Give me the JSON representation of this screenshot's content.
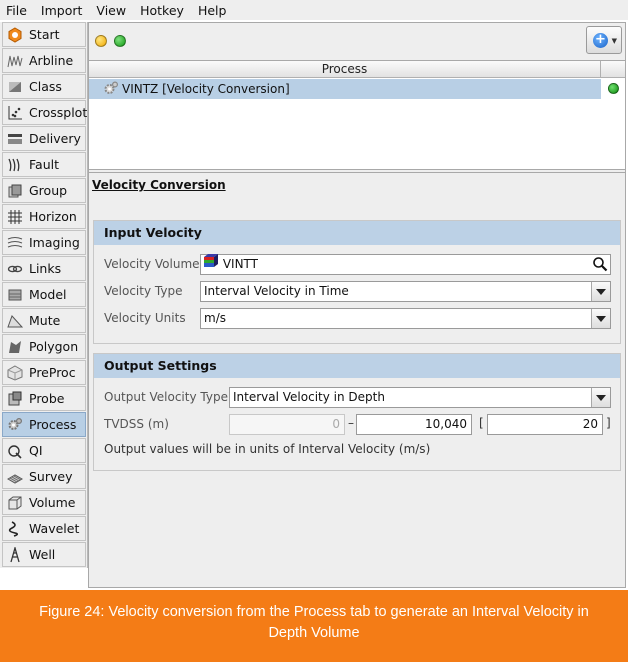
{
  "menu": [
    "File",
    "Import",
    "View",
    "Hotkey",
    "Help"
  ],
  "sidebar": {
    "tabs": [
      {
        "label": "Start",
        "icon": "start-icon"
      },
      {
        "label": "Arbline",
        "icon": "arbline-icon"
      },
      {
        "label": "Class",
        "icon": "class-icon"
      },
      {
        "label": "Crossplot",
        "icon": "crossplot-icon"
      },
      {
        "label": "Delivery",
        "icon": "delivery-icon"
      },
      {
        "label": "Fault",
        "icon": "fault-icon"
      },
      {
        "label": "Group",
        "icon": "group-icon"
      },
      {
        "label": "Horizon",
        "icon": "horizon-icon"
      },
      {
        "label": "Imaging",
        "icon": "imaging-icon"
      },
      {
        "label": "Links",
        "icon": "links-icon"
      },
      {
        "label": "Model",
        "icon": "model-icon"
      },
      {
        "label": "Mute",
        "icon": "mute-icon"
      },
      {
        "label": "Polygon",
        "icon": "polygon-icon"
      },
      {
        "label": "PreProc",
        "icon": "preproc-icon"
      },
      {
        "label": "Probe",
        "icon": "probe-icon"
      },
      {
        "label": "Process",
        "icon": "process-icon",
        "active": true
      },
      {
        "label": "QI",
        "icon": "qi-icon"
      },
      {
        "label": "Survey",
        "icon": "survey-icon"
      },
      {
        "label": "Volume",
        "icon": "volume-icon"
      },
      {
        "label": "Wavelet",
        "icon": "wavelet-icon"
      },
      {
        "label": "Well",
        "icon": "well-icon"
      }
    ]
  },
  "toolbar": {
    "status_dots": [
      "yellow",
      "green"
    ],
    "add_button_icon": "add-icon"
  },
  "process_table": {
    "header": "Process",
    "rows": [
      {
        "label": "VINTZ [Velocity Conversion]",
        "status": "green",
        "icon": "gear-icon"
      }
    ]
  },
  "panel": {
    "title": "Velocity Conversion",
    "input_velocity": {
      "header": "Input Velocity",
      "volume_label": "Velocity Volume",
      "volume_value": "VINTT",
      "volume_icon": "volume-cube-icon",
      "type_label": "Velocity Type",
      "type_value": "Interval Velocity in Time",
      "units_label": "Velocity Units",
      "units_value": "m/s"
    },
    "output_settings": {
      "header": "Output Settings",
      "type_label": "Output Velocity Type",
      "type_value": "Interval Velocity in Depth",
      "tvdss_label": "TVDSS (m)",
      "tvdss_min": "0",
      "tvdss_max": "10,040",
      "tvdss_step": "20",
      "dash": "–",
      "open_bracket": "[",
      "close_bracket": "]",
      "note": "Output values will be in units of Interval Velocity (m/s)"
    }
  },
  "caption": "Figure 24: Velocity conversion from the Process tab to generate an Interval Velocity in Depth Volume",
  "colors": {
    "accent": "#f47c16",
    "selection": "#b8cfe5",
    "section_header": "#bcd1e6"
  }
}
